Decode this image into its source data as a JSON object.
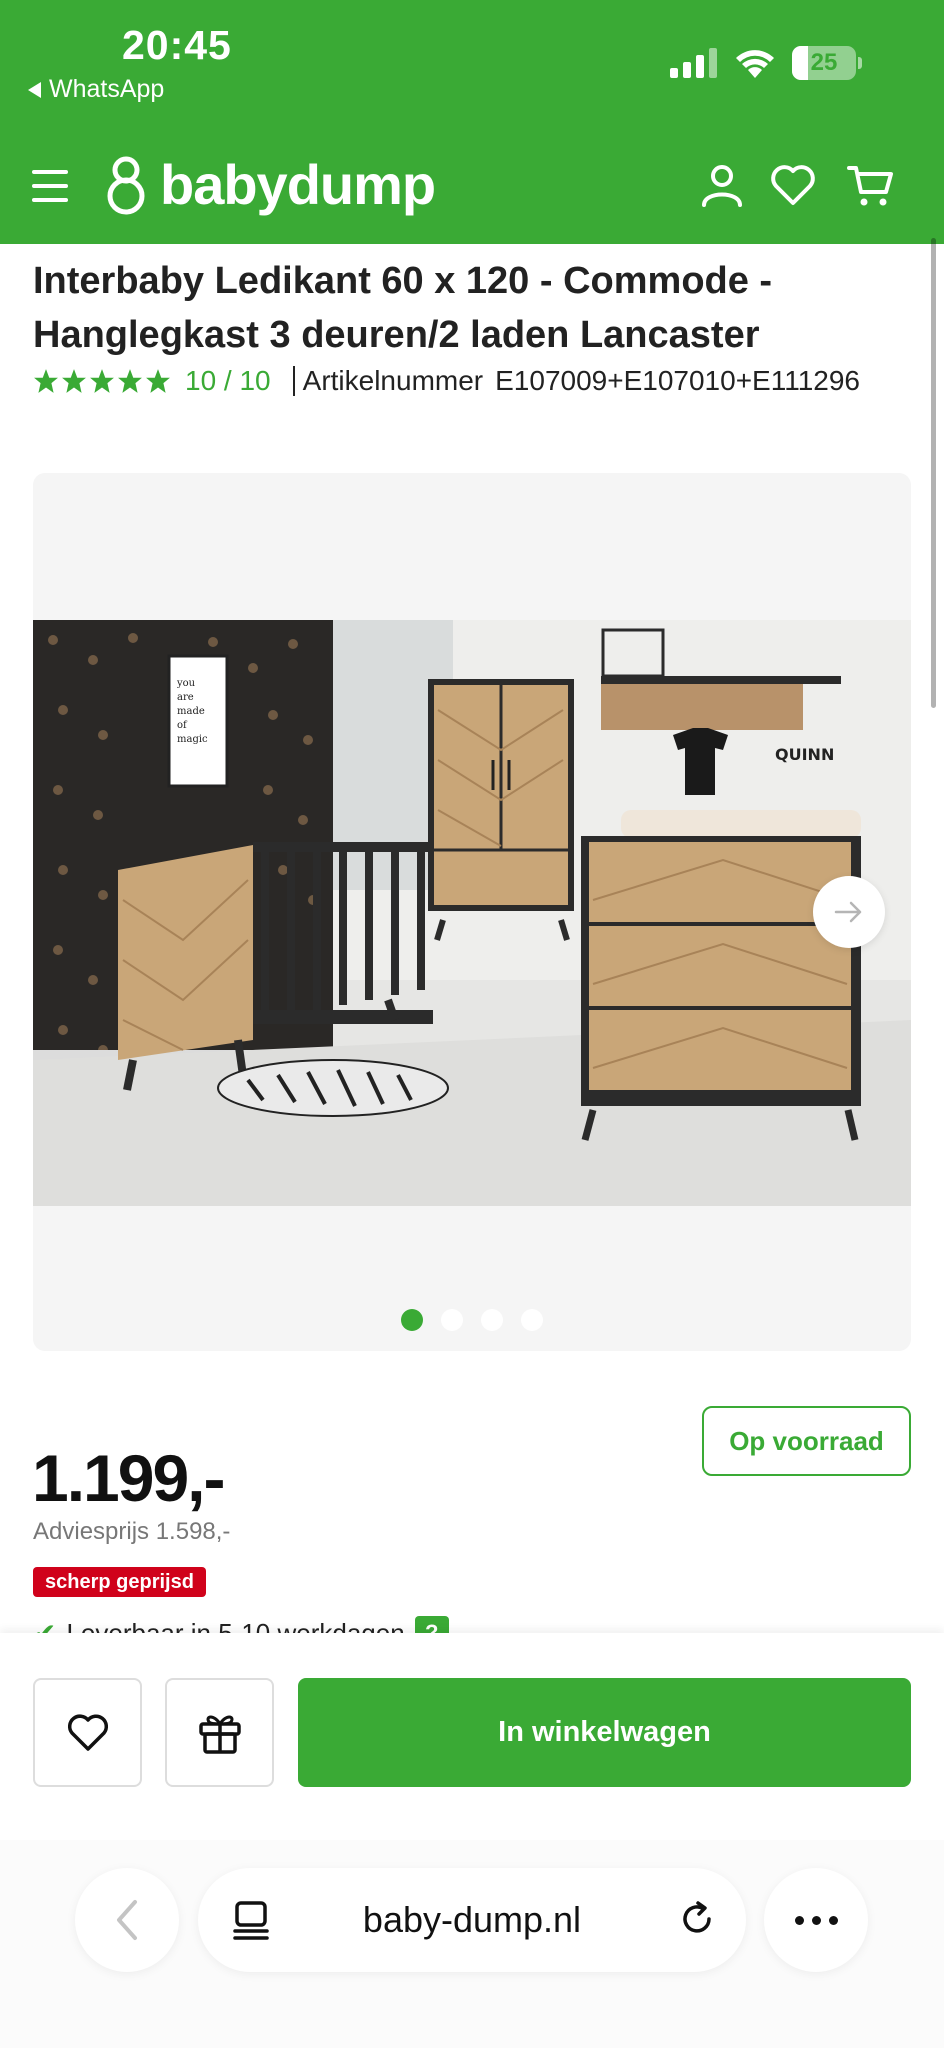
{
  "status_bar": {
    "time": "20:45",
    "back_app": "WhatsApp",
    "battery": "25"
  },
  "header": {
    "brand": "babydump",
    "icons": [
      "menu-icon",
      "user-icon",
      "heart-icon",
      "cart-icon"
    ],
    "color": "#3aaa35"
  },
  "product": {
    "title": "Interbaby Ledikant 60 x 120 - Commode - Hanglegkast 3 deuren/2 laden Lancaster",
    "rating": "10 / 10",
    "article_label": "Artikelnummer",
    "article_number": "E107009+E107010+E111296"
  },
  "gallery": {
    "poster_text": "you are made of magic",
    "wall_text": "QUINN",
    "slides": 4,
    "active_slide": 1
  },
  "pricing": {
    "stock": "Op voorraad",
    "price": "1.199,-",
    "advice_price": "Adviesprijs 1.598,-",
    "badge": "scherp geprijsd",
    "delivery": "Leverbaar in 5-10 werkdagen",
    "help": "?"
  },
  "actions": {
    "cart_label": "In winkelwagen"
  },
  "browser": {
    "url": "baby-dump.nl"
  },
  "colors": {
    "brand_green": "#3aaa35",
    "badge_red": "#d0021b"
  }
}
